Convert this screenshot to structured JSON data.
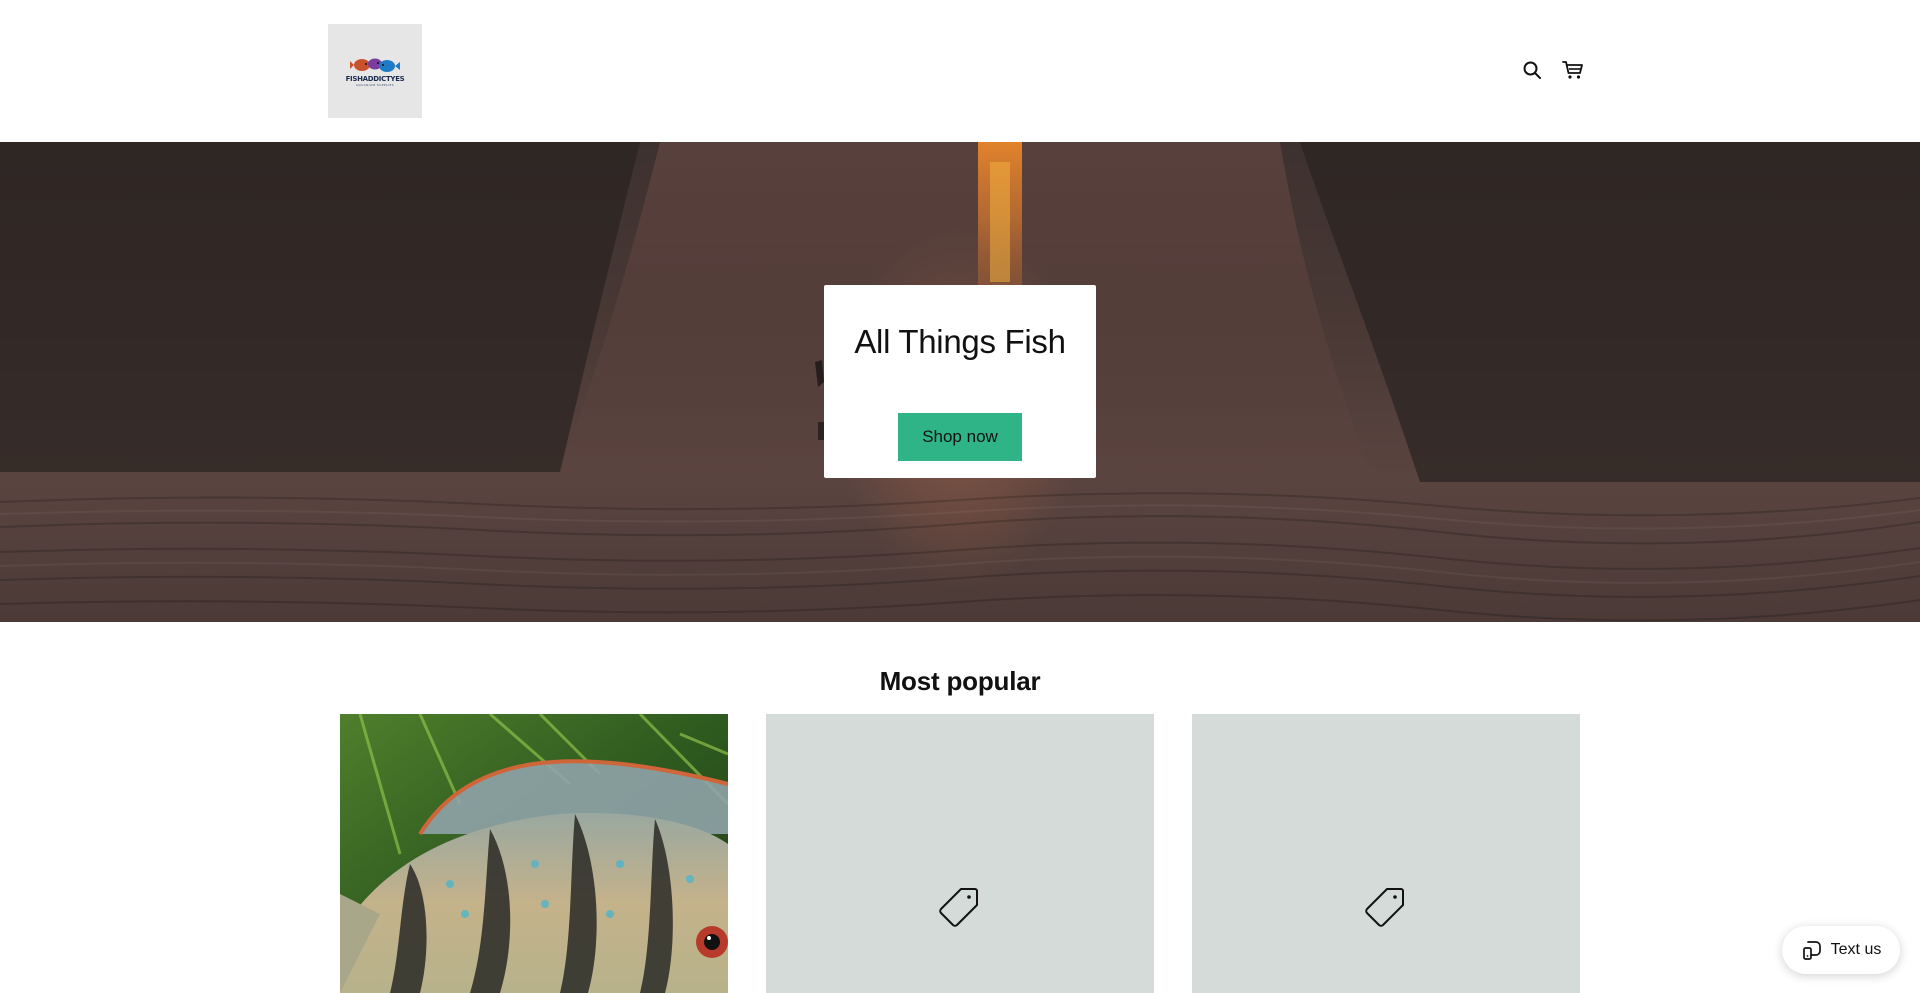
{
  "header": {
    "logo_text": "FISHADDICTYES",
    "logo_subtext": "AQUARIUM SUPPLIES",
    "icons": [
      "search-icon",
      "cart-icon"
    ]
  },
  "hero": {
    "title": "All Things Fish",
    "button_label": "Shop now"
  },
  "popular": {
    "title": "Most popular",
    "cards": [
      {
        "image": "cichlid-fish-photo"
      },
      {
        "image": "tag-icon-placeholder"
      },
      {
        "image": "tag-icon-placeholder"
      }
    ]
  },
  "chat": {
    "label": "Text us",
    "icon": "chat-icon"
  },
  "colors": {
    "accent": "#2eb487",
    "placeholder": "#d4dbd9",
    "logo_bg": "#e6e6e6"
  }
}
